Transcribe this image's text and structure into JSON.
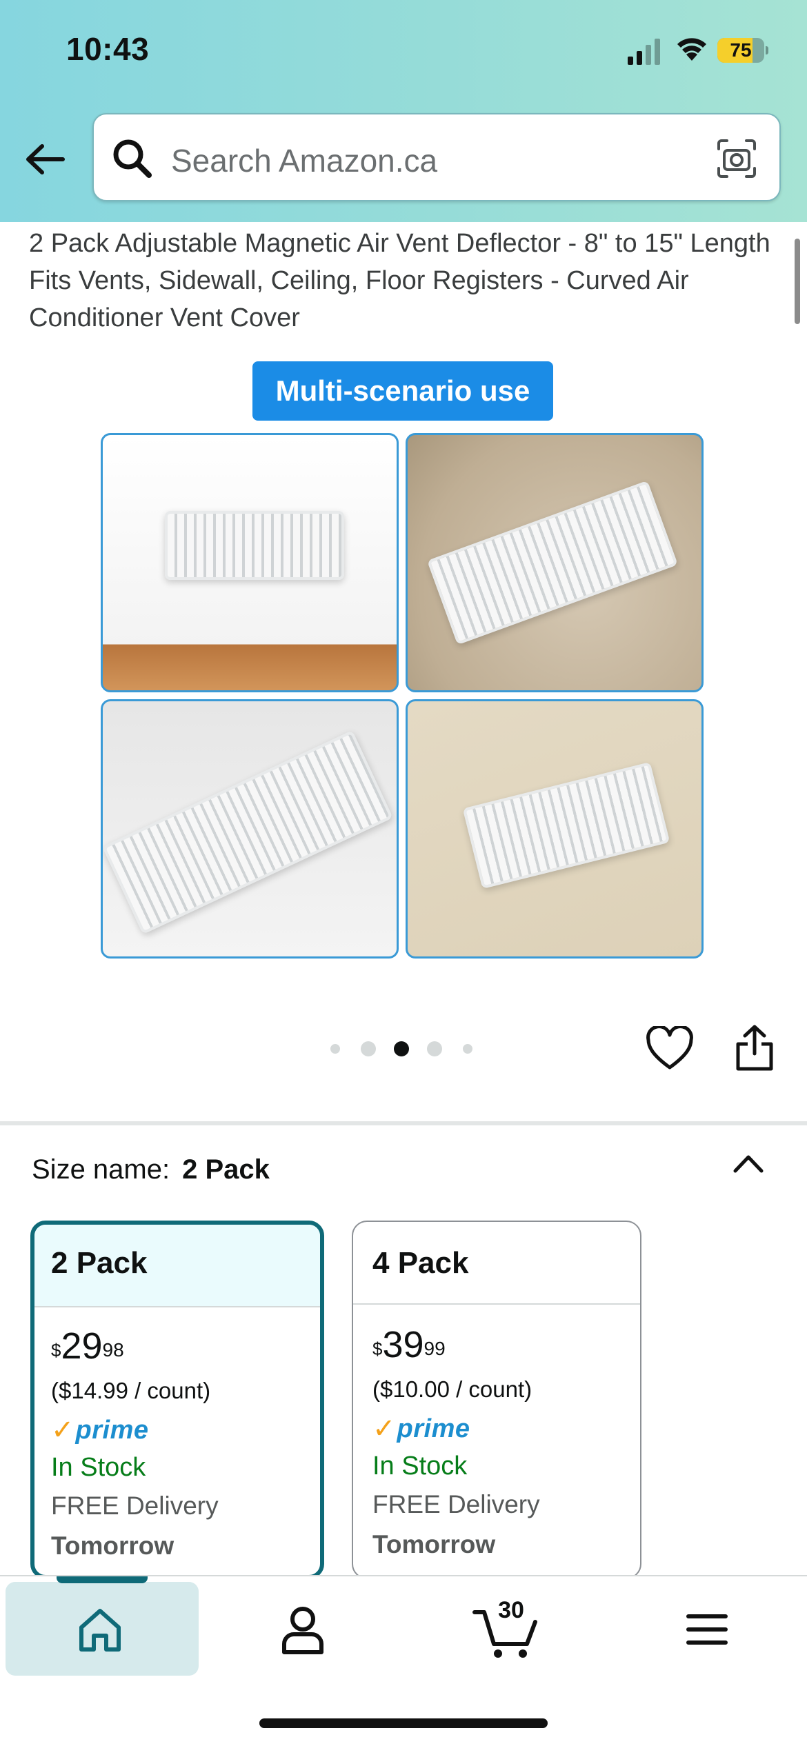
{
  "status_bar": {
    "time": "10:43",
    "battery_level": "75",
    "battery_fraction": 0.75
  },
  "search": {
    "placeholder": "Search Amazon.ca"
  },
  "product": {
    "title": "2 Pack Adjustable Magnetic Air Vent Deflector - 8\" to 15\" Length Fits Vents, Sidewall, Ceiling, Floor Registers - Curved Air Conditioner Vent Cover",
    "image_badge": "Multi-scenario use",
    "image_count": 5,
    "active_image_index": 2
  },
  "size_section": {
    "label": "Size name:",
    "selected": "2 Pack",
    "options": [
      {
        "name": "2 Pack",
        "currency": "$",
        "price_whole": "29",
        "price_cents": "98",
        "per_count": "($14.99 / count)",
        "prime": "prime",
        "stock": "In Stock",
        "delivery": "FREE Delivery",
        "delivery_day": "Tomorrow",
        "selected": true
      },
      {
        "name": "4 Pack",
        "currency": "$",
        "price_whole": "39",
        "price_cents": "99",
        "per_count": "($10.00 / count)",
        "prime": "prime",
        "stock": "In Stock",
        "delivery": "FREE Delivery",
        "delivery_day": "Tomorrow",
        "selected": false
      }
    ]
  },
  "bottom_nav": {
    "cart_count": "30"
  },
  "colors": {
    "accent_teal": "#0f6a78",
    "in_stock_green": "#067d19",
    "prime_blue": "#1c8ecf",
    "prime_check": "#f4a11a",
    "badge_blue": "#1b8ce6"
  }
}
